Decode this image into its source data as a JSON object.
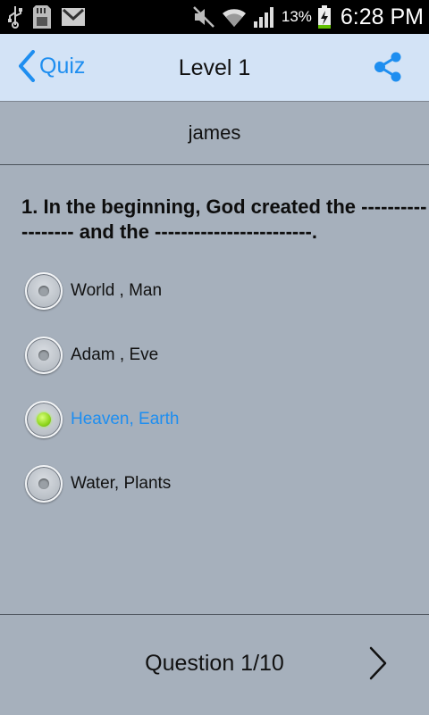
{
  "status_bar": {
    "battery_pct": "13%",
    "time": "6:28 PM",
    "icons": [
      "usb-icon",
      "sd-card-icon",
      "gmail-icon",
      "mute-icon",
      "wifi-icon",
      "signal-icon",
      "battery-charging-icon"
    ]
  },
  "nav": {
    "back_label": "Quiz",
    "title": "Level 1",
    "share_icon": "share-icon",
    "accent_color": "#1e8ef0"
  },
  "user": {
    "name": "james"
  },
  "question": {
    "text": "1. In the beginning, God created the ------------------ and the ------------------------."
  },
  "options": [
    {
      "label": "World , Man",
      "selected": false
    },
    {
      "label": "Adam , Eve",
      "selected": false
    },
    {
      "label": "Heaven, Earth",
      "selected": true
    },
    {
      "label": "Water, Plants",
      "selected": false
    }
  ],
  "footer": {
    "counter": "Question 1/10",
    "next_icon": "chevron-right-icon"
  }
}
